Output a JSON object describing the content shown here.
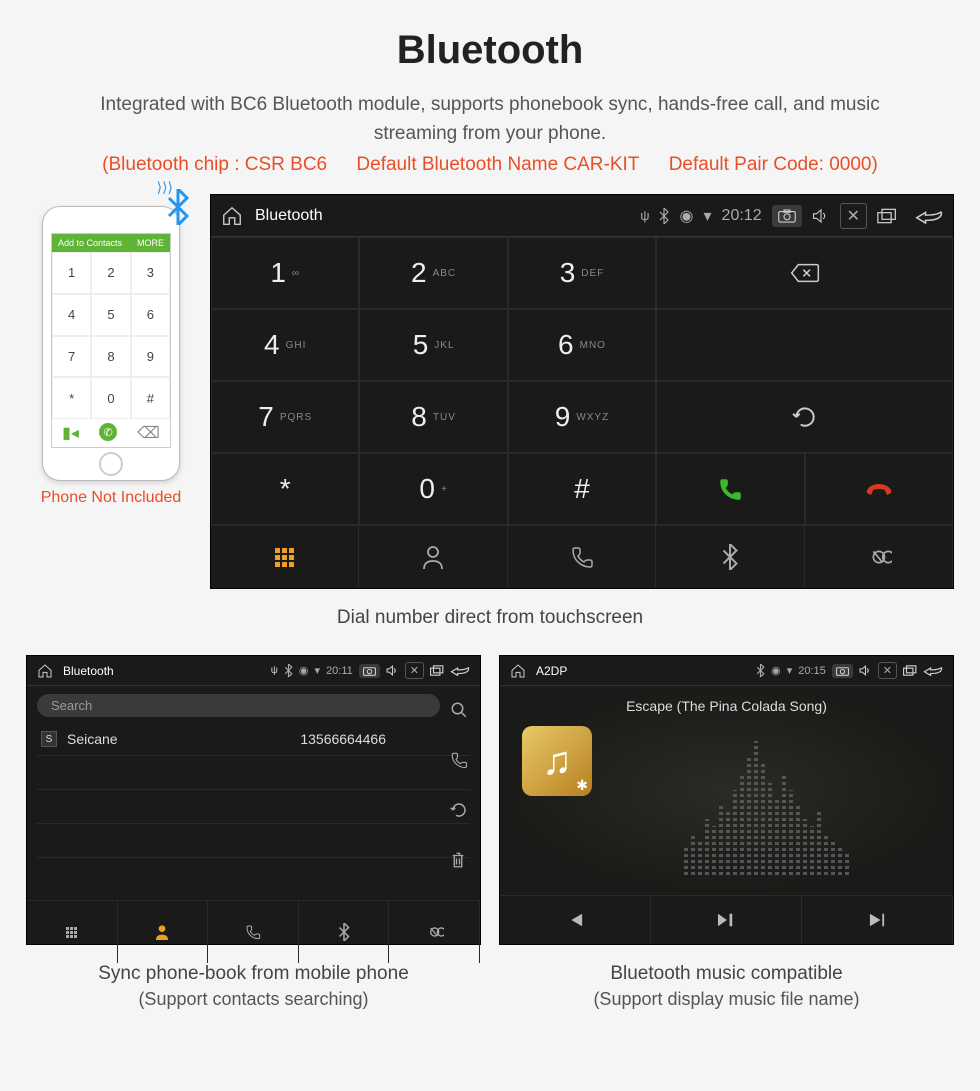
{
  "header": {
    "title": "Bluetooth",
    "subtitle": "Integrated with BC6 Bluetooth module, supports phonebook sync, hands-free call, and music streaming from your phone.",
    "spec_chip": "(Bluetooth chip : CSR BC6",
    "spec_name": "Default Bluetooth Name CAR-KIT",
    "spec_code": "Default Pair Code: 0000)"
  },
  "phone": {
    "caption": "Phone Not Included",
    "top_label": "Add to Contacts",
    "top_more": "MORE"
  },
  "main_screen": {
    "status": {
      "title": "Bluetooth",
      "time": "20:12"
    },
    "keys": [
      {
        "n": "1",
        "s": "∞"
      },
      {
        "n": "2",
        "s": "ABC"
      },
      {
        "n": "3",
        "s": "DEF"
      },
      {
        "n": "4",
        "s": "GHI"
      },
      {
        "n": "5",
        "s": "JKL"
      },
      {
        "n": "6",
        "s": "MNO"
      },
      {
        "n": "7",
        "s": "PQRS"
      },
      {
        "n": "8",
        "s": "TUV"
      },
      {
        "n": "9",
        "s": "WXYZ"
      },
      {
        "n": "*",
        "s": ""
      },
      {
        "n": "0",
        "s": "+"
      },
      {
        "n": "#",
        "s": ""
      }
    ],
    "caption": "Dial number direct from touchscreen"
  },
  "phonebook": {
    "status": {
      "title": "Bluetooth",
      "time": "20:11"
    },
    "search_placeholder": "Search",
    "contact": {
      "badge": "S",
      "name": "Seicane",
      "number": "13566664466"
    },
    "caption1": "Sync phone-book from mobile phone",
    "caption2": "(Support contacts searching)"
  },
  "music": {
    "status": {
      "title": "A2DP",
      "time": "20:15"
    },
    "song": "Escape (The Pina Colada Song)",
    "caption1": "Bluetooth music compatible",
    "caption2": "(Support display music file name)"
  }
}
